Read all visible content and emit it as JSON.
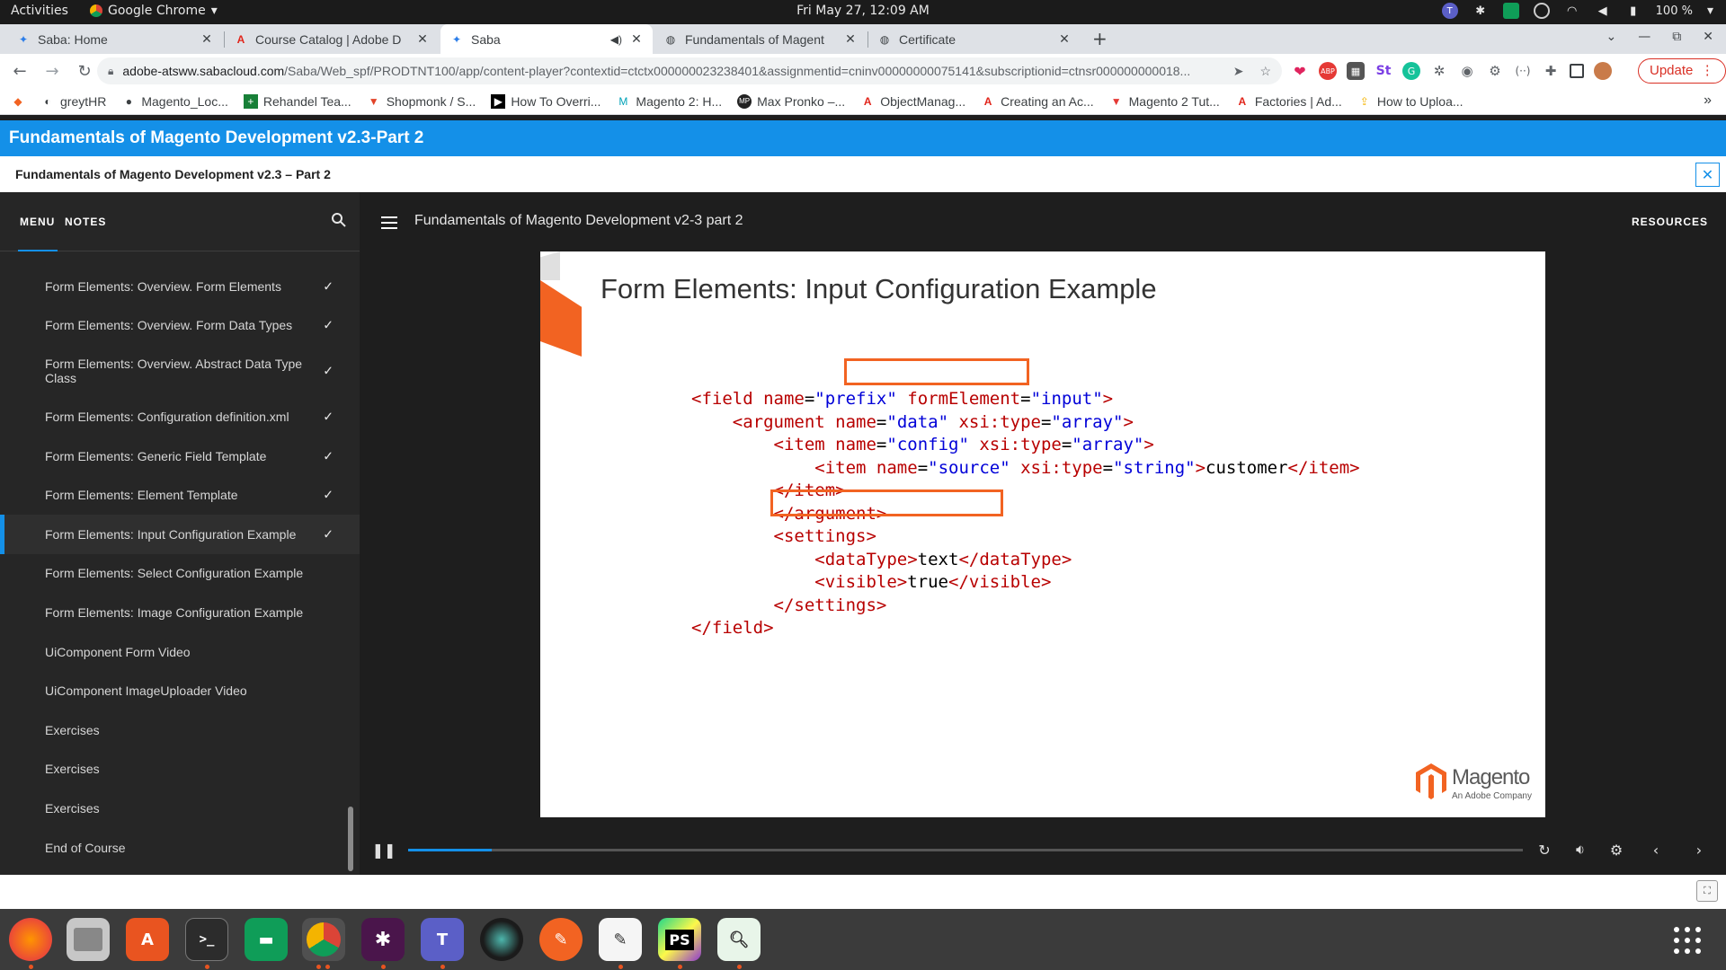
{
  "system": {
    "activities": "Activities",
    "app_name": "Google Chrome",
    "clock": "Fri May 27, 12:09 AM",
    "battery": "100 %"
  },
  "tabs": [
    {
      "title": "Saba: Home",
      "icon": "saba-icon",
      "active": false
    },
    {
      "title": "Course Catalog | Adobe D",
      "icon": "adobe-icon",
      "active": false
    },
    {
      "title": "Saba",
      "icon": "saba-icon",
      "active": true
    },
    {
      "title": "Fundamentals of Magent",
      "icon": "globe-icon",
      "active": false
    },
    {
      "title": "Certificate",
      "icon": "globe-icon",
      "active": false
    }
  ],
  "address": {
    "host": "adobe-atsww.sabacloud.com",
    "path": "/Saba/Web_spf/PRODTNT100/app/content-player?contextid=ctctx000000023238401&assignmentid=cninv00000000075141&subscriptionid=ctnsr000000000018..."
  },
  "update_label": "Update",
  "bookmarks": [
    {
      "label": "",
      "icon": "magento-icon"
    },
    {
      "label": "greytHR",
      "icon": "greythr-icon"
    },
    {
      "label": "Magento_Loc...",
      "icon": "github-icon"
    },
    {
      "label": "Rehandel Tea...",
      "icon": "plus-icon"
    },
    {
      "label": "Shopmonk / S...",
      "icon": "gitlab-icon"
    },
    {
      "label": "How To Overri...",
      "icon": "video-icon"
    },
    {
      "label": "Magento 2: H...",
      "icon": "m-icon"
    },
    {
      "label": "Max Pronko –...",
      "icon": "mp-icon"
    },
    {
      "label": "ObjectManag...",
      "icon": "adobe-icon"
    },
    {
      "label": "Creating an Ac...",
      "icon": "adobe-icon"
    },
    {
      "label": "Magento 2 Tut...",
      "icon": "triangle-icon"
    },
    {
      "label": "Factories | Ad...",
      "icon": "adobe-icon"
    },
    {
      "label": "How to Uploa...",
      "icon": "upload-icon"
    }
  ],
  "course": {
    "header": "Fundamentals of Magento Development v2.3-Part 2",
    "subheader": "Fundamentals of Magento Development v2.3 – Part 2"
  },
  "sidebar": {
    "tab_menu": "MENU",
    "tab_notes": "NOTES",
    "items": [
      {
        "label": "Form Elements: Overview. Form Elements",
        "done": true
      },
      {
        "label": "Form Elements: Overview. Form Data Types",
        "done": true
      },
      {
        "label": "Form Elements: Overview. Abstract Data Type Class",
        "done": true
      },
      {
        "label": "Form Elements: Configuration definition.xml",
        "done": true
      },
      {
        "label": "Form Elements: Generic Field Template",
        "done": true
      },
      {
        "label": "Form Elements: Element Template",
        "done": true
      },
      {
        "label": "Form Elements: Input Configuration Example",
        "done": true
      },
      {
        "label": "Form Elements: Select Configuration Example",
        "done": false
      },
      {
        "label": "Form Elements: Image Configuration Example",
        "done": false
      },
      {
        "label": "UiComponent Form Video",
        "done": false
      },
      {
        "label": "UiComponent ImageUploader Video",
        "done": false
      },
      {
        "label": "Exercises",
        "done": false
      },
      {
        "label": "Exercises",
        "done": false
      },
      {
        "label": "Exercises",
        "done": false
      },
      {
        "label": "End of Course",
        "done": false
      }
    ],
    "active_index": 6
  },
  "player": {
    "title": "Fundamentals of Magento Development v2-3 part 2",
    "resources": "RESOURCES",
    "progress": 0.075
  },
  "slide": {
    "title": "Form Elements: Input Configuration Example",
    "logo_word": "Magento",
    "logo_sub": "An Adobe Company",
    "code": {
      "l1_open": "<field ",
      "l1_attr1": "name",
      "l1_eq1": "=",
      "l1_val1": "\"prefix\"",
      "l1_attr2": "formElement",
      "l1_eq2": "=",
      "l1_val2": "\"input\"",
      "l1_close": ">",
      "l2_open": "<argument ",
      "l2_attr1": "name",
      "l2_eq1": "=",
      "l2_val1": "\"data\"",
      "l2_attr2": " xsi:type",
      "l2_eq2": "=",
      "l2_val2": "\"array\"",
      "l2_close": ">",
      "l3_open": "<item ",
      "l3_attr1": "name",
      "l3_eq1": "=",
      "l3_val1": "\"config\"",
      "l3_attr2": " xsi:type",
      "l3_eq2": "=",
      "l3_val2": "\"array\"",
      "l3_close": ">",
      "l4_open": "<item ",
      "l4_attr1": "name",
      "l4_eq1": "=",
      "l4_val1": "\"source\"",
      "l4_attr2": " xsi:type",
      "l4_eq2": "=",
      "l4_val2": "\"string\"",
      "l4_close": ">",
      "l4_text": "customer",
      "l4_end": "</item>",
      "l5": "</item>",
      "l6": "</argument>",
      "l7": "<settings>",
      "l8_open": "<dataType>",
      "l8_text": "text",
      "l8_end": "</dataType>",
      "l9_open": "<visible>",
      "l9_text": "true",
      "l9_end": "</visible>",
      "l10": "</settings>",
      "l11": "</field>"
    }
  },
  "colors": {
    "brand_blue": "#1490e8",
    "magento_orange": "#f26322"
  }
}
